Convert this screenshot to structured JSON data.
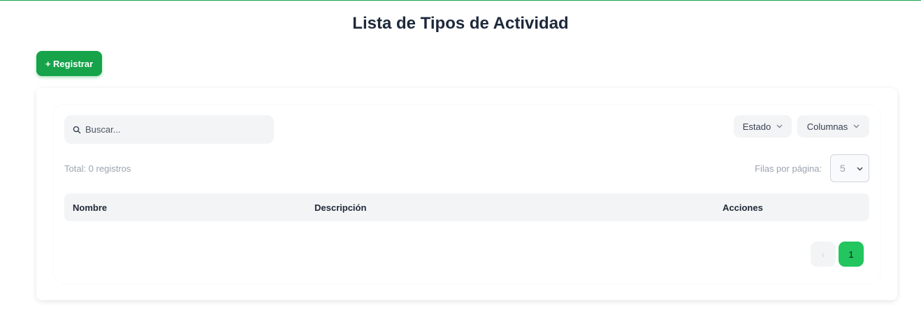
{
  "page": {
    "title": "Lista de Tipos de Actividad"
  },
  "toolbar": {
    "register_label": "+ Registrar"
  },
  "search": {
    "placeholder": "Buscar...",
    "value": ""
  },
  "filters": {
    "estado_label": "Estado",
    "columnas_label": "Columnas"
  },
  "summary": {
    "total_text": "Total: 0 registros",
    "rows_per_page_label": "Filas por página:",
    "rows_per_page_value": "5"
  },
  "table": {
    "columns": [
      "Nombre",
      "Descripción",
      "Acciones"
    ],
    "rows": []
  },
  "pagination": {
    "prev_glyph": "‹",
    "current_page": "1"
  },
  "colors": {
    "accent": "#16a34a",
    "active_page": "#22c55e",
    "muted_bg": "#f3f4f6"
  }
}
